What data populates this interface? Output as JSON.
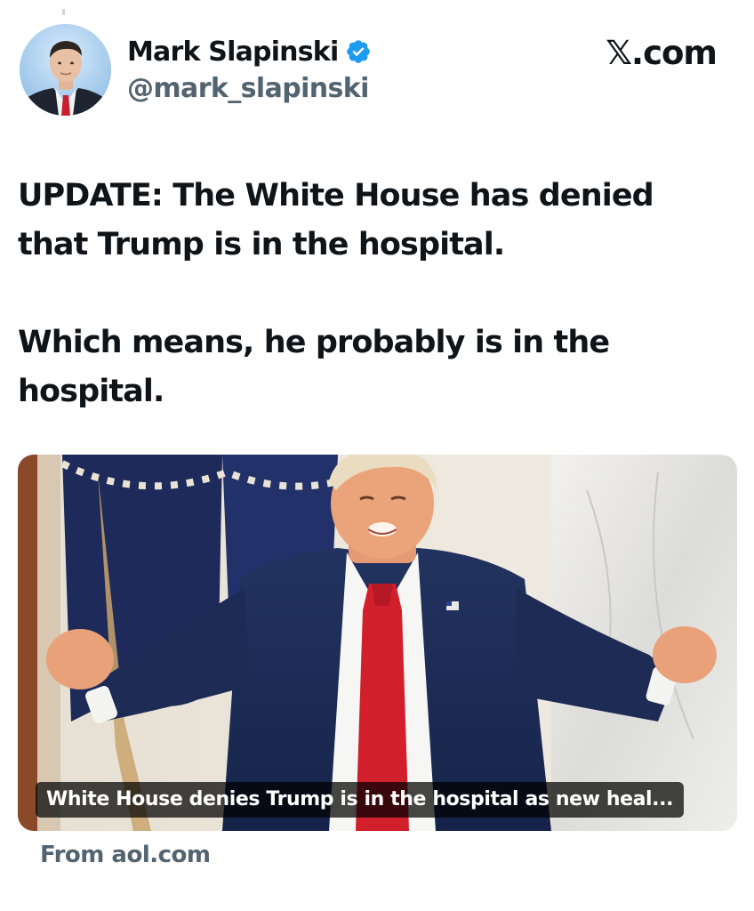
{
  "tweet": {
    "author": {
      "display_name": "Mark Slapinski",
      "handle": "@mark_slapinski",
      "verified": true
    },
    "brand": "𝕏.com",
    "text": {
      "paragraph_1": "UPDATE: The White House has denied that Trump is in the hospital.",
      "paragraph_2": "Which means, he probably is in the hospital."
    },
    "link_card": {
      "caption": "White House denies Trump is in the hospital as new heal...",
      "source": "From aol.com"
    }
  },
  "icons": {
    "verified": "verified-badge-icon",
    "avatar": "profile-photo"
  },
  "colors": {
    "verified_blue": "#1d9bf0",
    "text_primary": "#0f1419",
    "text_secondary": "#536471",
    "tie_red": "#d11f2b",
    "suit_navy": "#1b2a55"
  }
}
